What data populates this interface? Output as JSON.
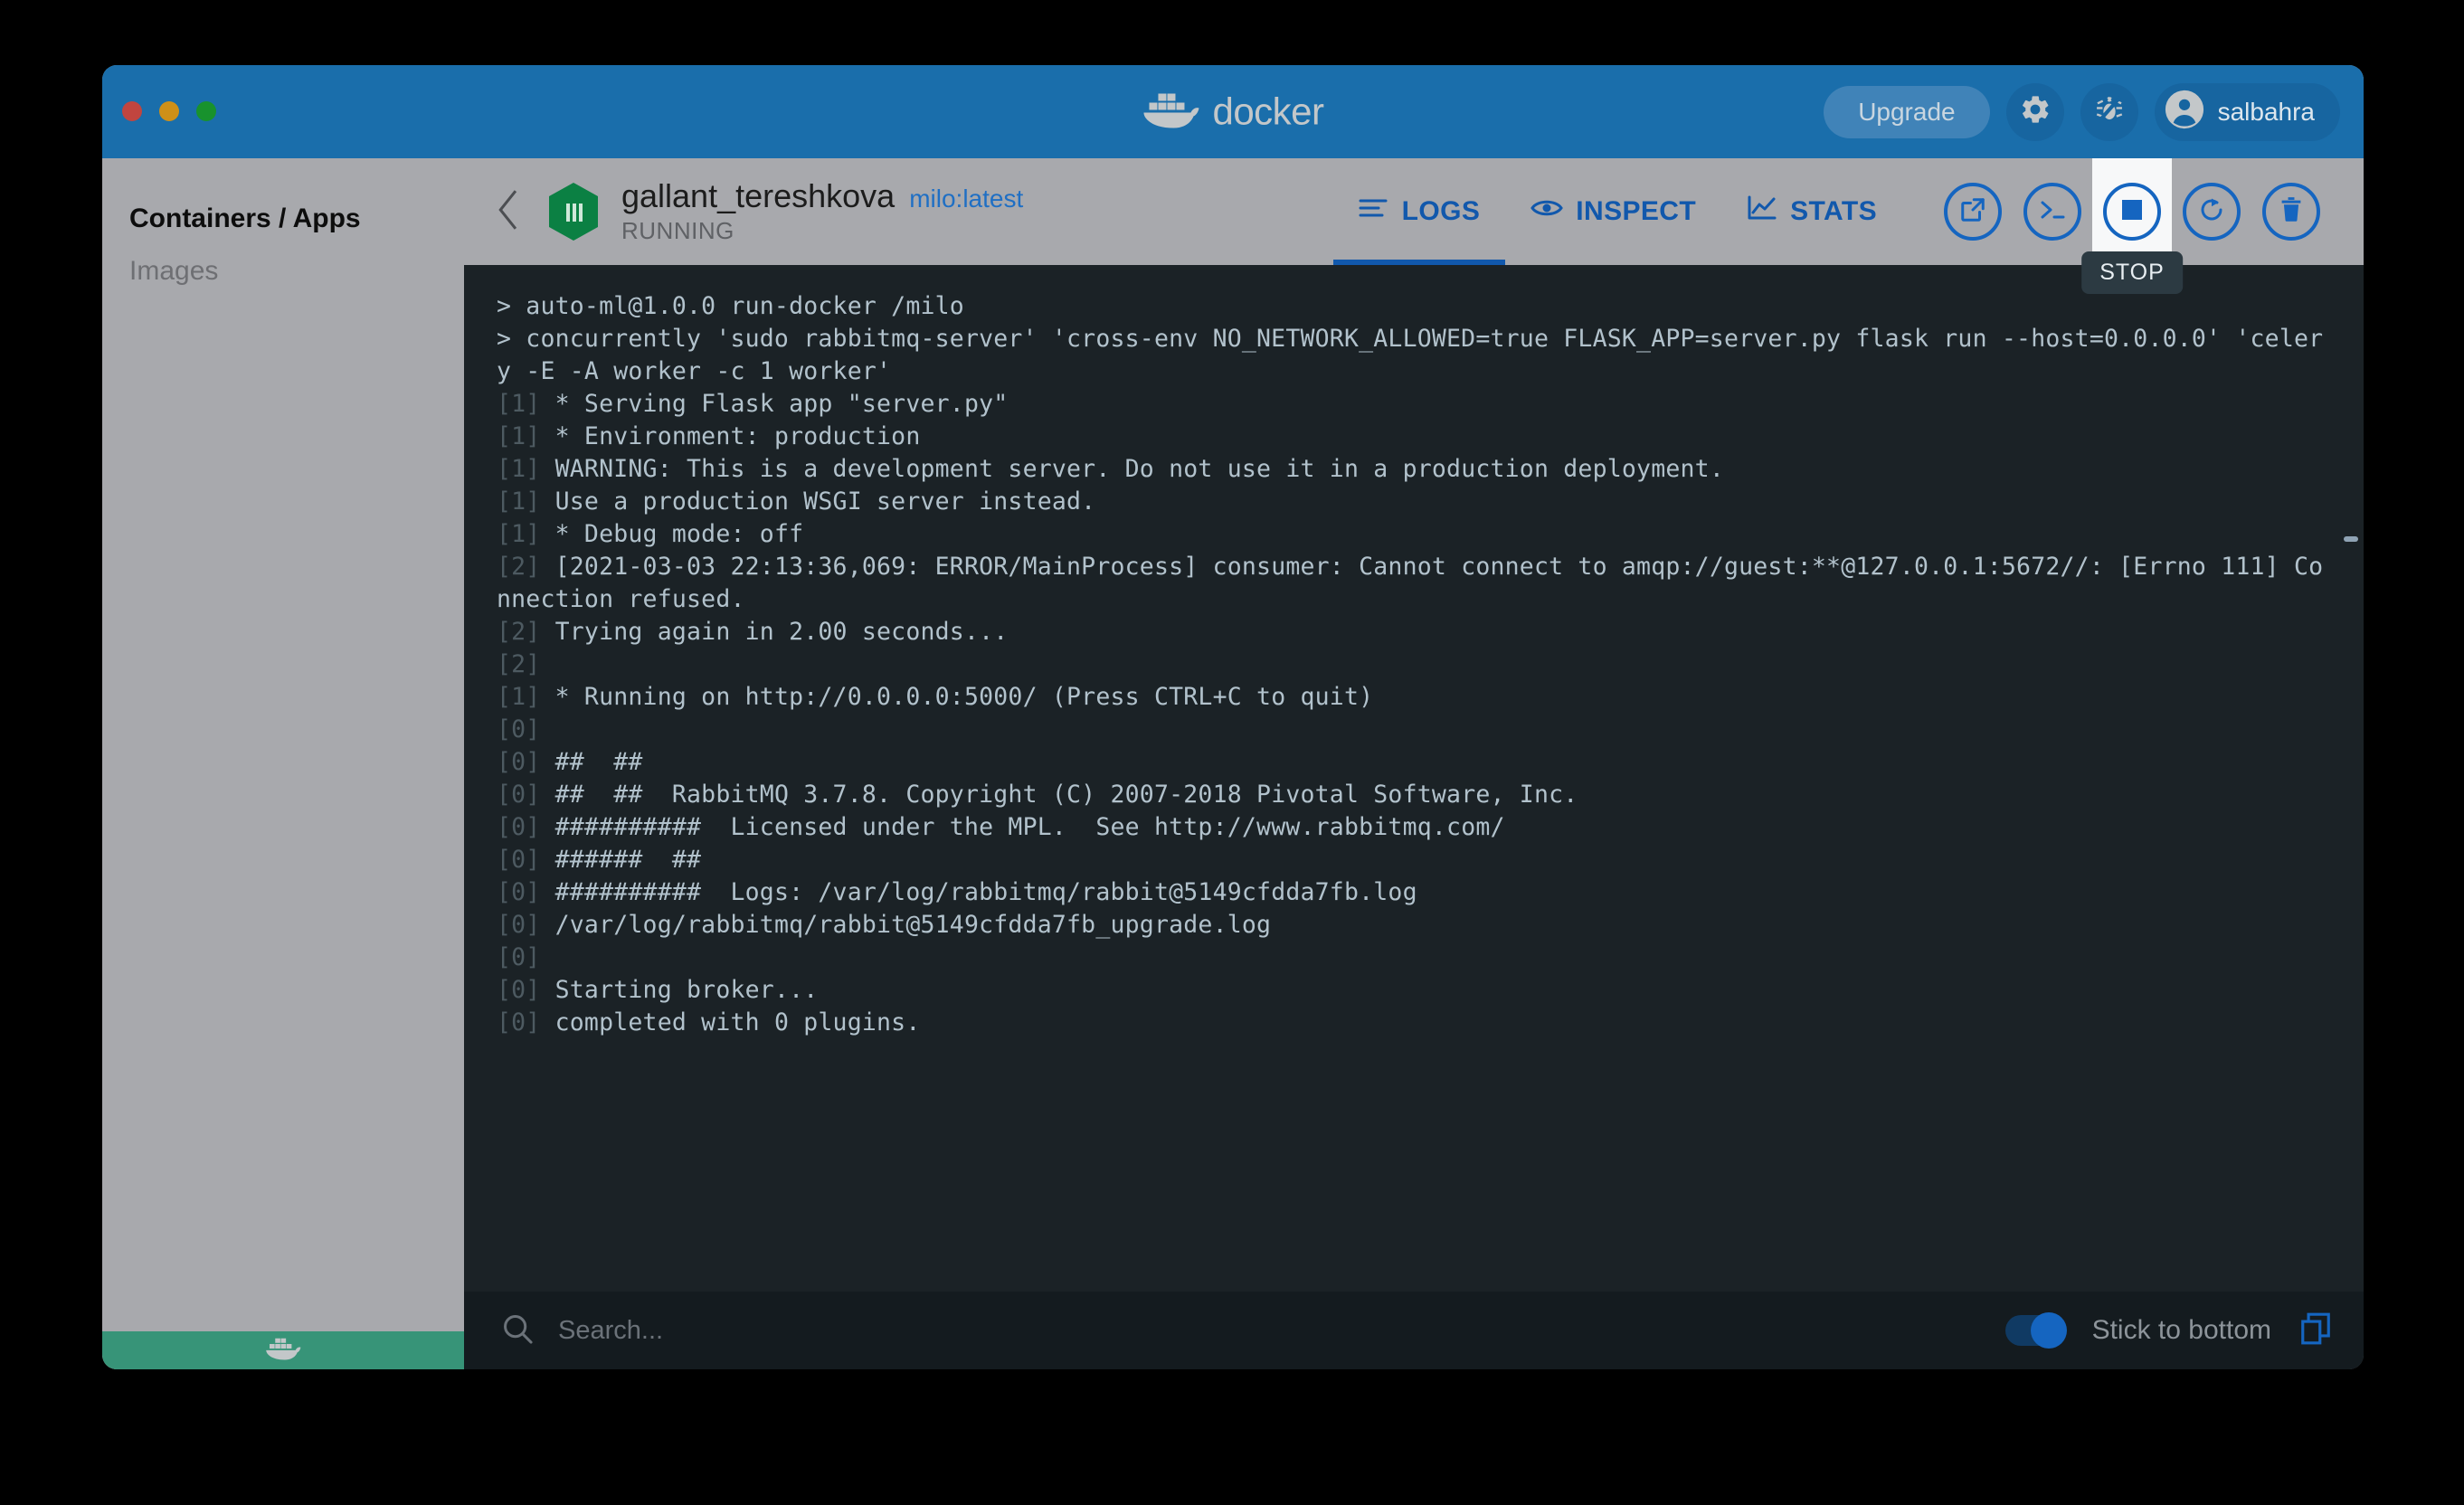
{
  "window": {
    "traffic_lights": [
      "close",
      "minimize",
      "zoom"
    ]
  },
  "titlebar": {
    "brand": "docker",
    "brand_icon": "docker-whale-icon",
    "upgrade_label": "Upgrade",
    "settings_icon": "gear-icon",
    "bug_icon": "bug-icon",
    "avatar_icon": "user-avatar-icon",
    "username": "salbahra",
    "background_color": "#1a6eab"
  },
  "sidebar": {
    "items": [
      {
        "label": "Containers / Apps",
        "active": true
      },
      {
        "label": "Images",
        "active": false
      }
    ],
    "status_bar_icon": "docker-whale-icon",
    "status_bar_color": "#379478"
  },
  "container_header": {
    "back_icon": "chevron-left-icon",
    "container_icon": "container-cube-icon",
    "name": "gallant_tereshkova",
    "image": "milo:latest",
    "state": "RUNNING",
    "tabs": [
      {
        "label": "LOGS",
        "icon": "logs-lines-icon",
        "active": true
      },
      {
        "label": "INSPECT",
        "icon": "eye-icon",
        "active": false
      },
      {
        "label": "STATS",
        "icon": "chart-line-icon",
        "active": false
      }
    ],
    "actions": [
      {
        "name": "open-in-browser",
        "icon": "external-link-icon",
        "highlighted": false
      },
      {
        "name": "cli",
        "icon": "terminal-prompt-icon",
        "highlighted": false
      },
      {
        "name": "stop",
        "icon": "stop-square-icon",
        "highlighted": true,
        "tooltip": "STOP"
      },
      {
        "name": "restart",
        "icon": "restart-circular-arrow-icon",
        "highlighted": false
      },
      {
        "name": "delete",
        "icon": "trash-icon",
        "highlighted": false
      }
    ],
    "accent_color": "#1158ac"
  },
  "logs": {
    "background_color": "#1b2226",
    "text_color": "#b2c2cc",
    "index_color": "#4d5a61",
    "lines": [
      {
        "idx": "",
        "text": "> auto-ml@1.0.0 run-docker /milo"
      },
      {
        "idx": "",
        "text": "> concurrently 'sudo rabbitmq-server' 'cross-env NO_NETWORK_ALLOWED=true FLASK_APP=server.py flask run --host=0.0.0.0' 'celery -E -A worker -c 1 worker'"
      },
      {
        "idx": "[1]",
        "text": "* Serving Flask app \"server.py\""
      },
      {
        "idx": "[1]",
        "text": "* Environment: production"
      },
      {
        "idx": "[1]",
        "text": "WARNING: This is a development server. Do not use it in a production deployment."
      },
      {
        "idx": "[1]",
        "text": "Use a production WSGI server instead."
      },
      {
        "idx": "[1]",
        "text": "* Debug mode: off"
      },
      {
        "idx": "[2]",
        "text": "[2021-03-03 22:13:36,069: ERROR/MainProcess] consumer: Cannot connect to amqp://guest:**@127.0.0.1:5672//: [Errno 111] Connection refused."
      },
      {
        "idx": "[2]",
        "text": "Trying again in 2.00 seconds..."
      },
      {
        "idx": "[2]",
        "text": ""
      },
      {
        "idx": "[1]",
        "text": "* Running on http://0.0.0.0:5000/ (Press CTRL+C to quit)"
      },
      {
        "idx": "[0]",
        "text": ""
      },
      {
        "idx": "[0]",
        "text": "##  ##"
      },
      {
        "idx": "[0]",
        "text": "##  ##  RabbitMQ 3.7.8. Copyright (C) 2007-2018 Pivotal Software, Inc."
      },
      {
        "idx": "[0]",
        "text": "##########  Licensed under the MPL.  See http://www.rabbitmq.com/"
      },
      {
        "idx": "[0]",
        "text": "######  ##"
      },
      {
        "idx": "[0]",
        "text": "##########  Logs: /var/log/rabbitmq/rabbit@5149cfdda7fb.log"
      },
      {
        "idx": "[0]",
        "text": "/var/log/rabbitmq/rabbit@5149cfdda7fb_upgrade.log"
      },
      {
        "idx": "[0]",
        "text": ""
      },
      {
        "idx": "[0]",
        "text": "Starting broker..."
      },
      {
        "idx": "[0]",
        "text": "completed with 0 plugins."
      }
    ]
  },
  "log_footer": {
    "search_icon": "search-icon",
    "search_value": "",
    "search_placeholder": "Search...",
    "stick_to_bottom_label": "Stick to bottom",
    "stick_to_bottom_on": true,
    "copy_icon": "copy-icon",
    "accent_color": "#1565c0"
  }
}
